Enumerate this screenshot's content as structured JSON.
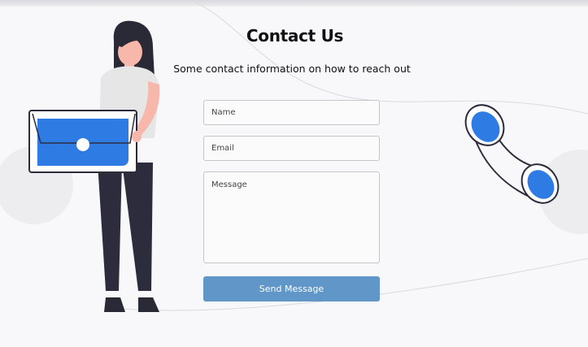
{
  "page": {
    "title": "Contact Us",
    "subtitle": "Some contact information on how to reach out"
  },
  "form": {
    "name_placeholder": "Name",
    "email_placeholder": "Email",
    "message_placeholder": "Message",
    "submit_label": "Send Message"
  },
  "illustration": {
    "left": "woman-with-envelope",
    "right": "phone-handset-icon"
  },
  "colors": {
    "accent": "#2f7be4",
    "button": "#6196c8",
    "background": "#f8f8fa",
    "text": "#111111"
  }
}
